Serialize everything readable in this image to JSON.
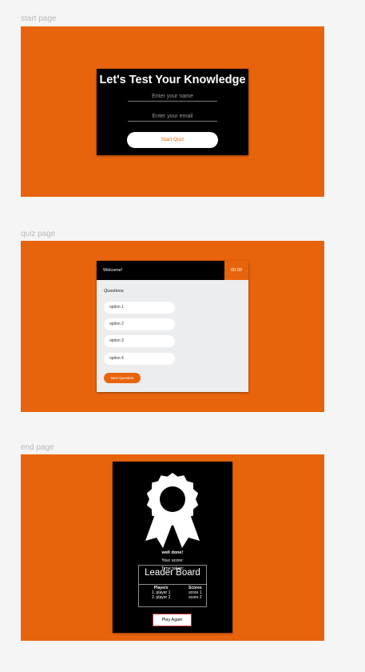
{
  "start_page": {
    "frame_label": "start page",
    "title": "Let's Test Your Knowledge",
    "name_placeholder": "Enter your name",
    "email_placeholder": "Enter your email",
    "start_button": "Start Quiz"
  },
  "quiz_page": {
    "frame_label": "quiz page",
    "welcome": "Welcome!",
    "timer": "00:00",
    "question": "Questions",
    "options": [
      "option 1",
      "option 2",
      "option 3",
      "option 4"
    ],
    "next_button": "Next Question"
  },
  "end_page": {
    "frame_label": "end page",
    "icon": "award-ribbon-icon",
    "well_done": "well done!",
    "your_score": "Your score:",
    "time_taken": "Time taken:",
    "leaderboard": {
      "title": "Leader Board",
      "players_header": "Players",
      "scores_header": "Scores",
      "players": [
        "1. player 1",
        "2. player 2"
      ],
      "scores": [
        "score 1",
        "score 2"
      ]
    },
    "play_again_button": "Play Again"
  },
  "colors": {
    "accent": "#e8640c",
    "canvas": "#f5f5f5",
    "card_dark": "#000000",
    "card_light": "#ecedef"
  }
}
